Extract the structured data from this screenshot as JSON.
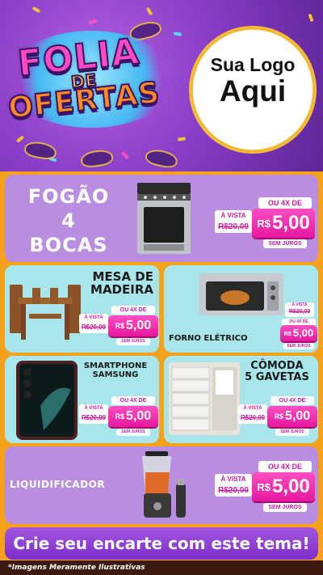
{
  "header": {
    "title_line1": "FOLIA",
    "title_line2": "DE",
    "title_line3": "OFERTAS",
    "logo_line1": "Sua Logo",
    "logo_line2": "Aqui"
  },
  "products": [
    {
      "name_lines": [
        "FOGÃO",
        "4",
        "BOCAS"
      ],
      "avista": "À VISTA",
      "old_price": "R$20,00",
      "installments": "OU 4X DE",
      "currency": "R$",
      "price": "5,00",
      "note": "SEM JUROS"
    },
    {
      "name_lines": [
        "MESA DE",
        "MADEIRA"
      ],
      "avista": "À VISTA",
      "old_price": "R$20,00",
      "installments": "OU 4X DE",
      "currency": "R$",
      "price": "5,00",
      "note": "SEM JUROS"
    },
    {
      "name_lines": [
        "FORNO ELÉTRICO"
      ],
      "avista": "À VISTA",
      "old_price": "R$20,00",
      "installments": "OU 4X DE",
      "currency": "R$",
      "price": "5,00",
      "note": "SEM JUROS"
    },
    {
      "name_lines": [
        "SMARTPHONE",
        "SAMSUNG"
      ],
      "avista": "À VISTA",
      "old_price": "R$20,00",
      "installments": "OU 4X DE",
      "currency": "R$",
      "price": "5,00",
      "note": "SEM JUROS"
    },
    {
      "name_lines": [
        "CÔMODA",
        "5 GAVETAS"
      ],
      "avista": "À VISTA",
      "old_price": "R$20,00",
      "installments": "OU 4X DE",
      "currency": "R$",
      "price": "5,00",
      "note": "SEM JUROS"
    },
    {
      "name_lines": [
        "LIQUIDIFICADOR"
      ],
      "avista": "À VISTA",
      "old_price": "R$20,00",
      "installments": "OU 4X DE",
      "currency": "R$",
      "price": "5,00",
      "note": "SEM JUROS"
    }
  ],
  "banner": "Crie seu encarte com este tema!",
  "footer": "*Imagens Meramente Ilustrativas",
  "colors": {
    "orange": "#f5a21a",
    "purple_panel": "#b98ee0",
    "aqua_panel": "#a8e6ec",
    "magenta": "#e6179e",
    "banner": "#8a35cf"
  }
}
